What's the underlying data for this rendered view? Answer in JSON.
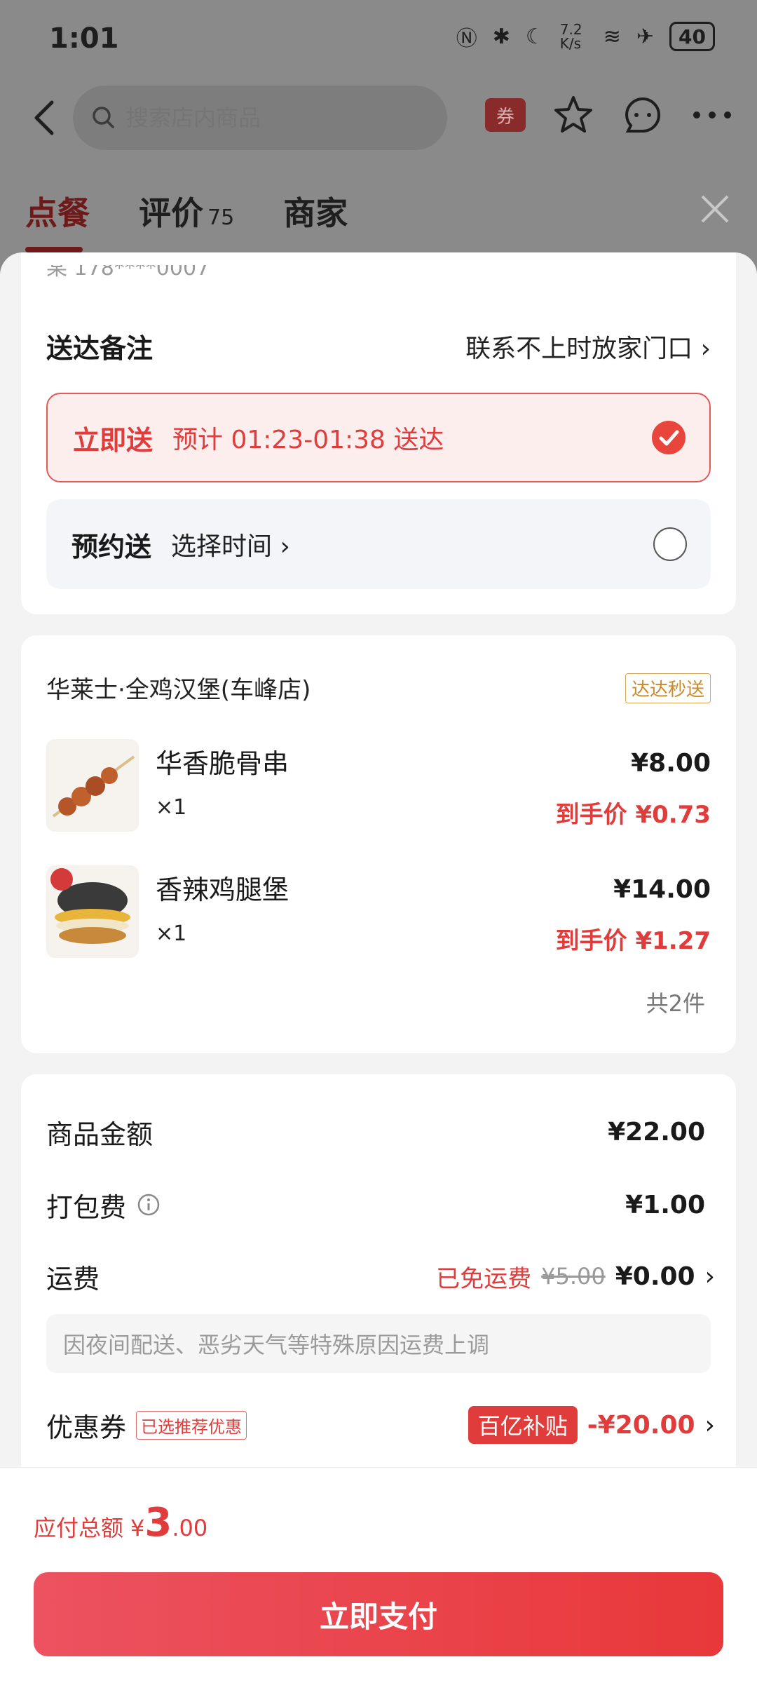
{
  "status_bar": {
    "time": "1:01",
    "net_speed": "7.2 K/s",
    "battery": "40"
  },
  "header": {
    "search_placeholder": "搜索店内商品",
    "coupon_label": "券"
  },
  "tabs": [
    {
      "label": "点餐",
      "count": ""
    },
    {
      "label": "评价",
      "count": "75"
    },
    {
      "label": "商家",
      "count": ""
    }
  ],
  "delivery": {
    "phone_peek": "某 178****0007",
    "remark_label": "送达备注",
    "remark_value": "联系不上时放家门口",
    "now_title": "立即送",
    "now_desc": "预计 01:23-01:38 送达",
    "sched_title": "预约送",
    "sched_desc": "选择时间"
  },
  "order": {
    "shop_name": "华莱士·全鸡汉堡(车峰店)",
    "shop_badge": "达达秒送",
    "items": [
      {
        "name": "华香脆骨串",
        "qty": "×1",
        "price": "¥8.00",
        "final_label": "到手价",
        "final_price": "¥0.73"
      },
      {
        "name": "香辣鸡腿堡",
        "qty": "×1",
        "price": "¥14.00",
        "final_label": "到手价",
        "final_price": "¥1.27"
      }
    ],
    "total_count": "共2件"
  },
  "fees": {
    "goods_label": "商品金额",
    "goods_value": "¥22.00",
    "pack_label": "打包费",
    "pack_value": "¥1.00",
    "ship_label": "运费",
    "ship_free": "已免运费",
    "ship_original": "¥5.00",
    "ship_value": "¥0.00",
    "ship_note": "因夜间配送、恶劣天气等特殊原因运费上调",
    "coupon_label": "优惠券",
    "coupon_tag": "已选推荐优惠",
    "subsidy": "百亿补贴",
    "discount": "-¥20.00"
  },
  "total": {
    "label": "应付总额",
    "yen": "¥",
    "int": "3",
    "dec": ".00"
  },
  "pay_button": "立即支付"
}
